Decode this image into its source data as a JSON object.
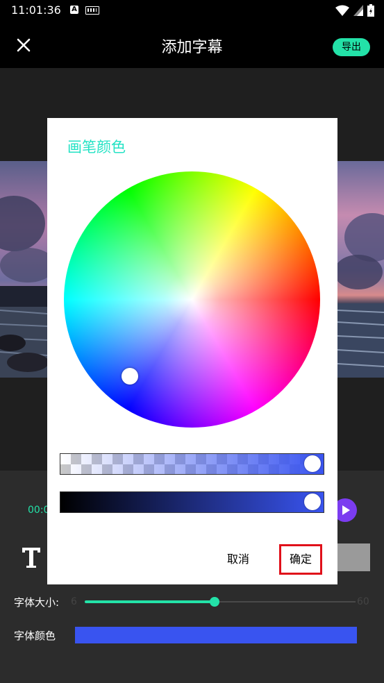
{
  "status_bar": {
    "time": "11:01:36",
    "a_indicator": "A",
    "icons": [
      "a-icon",
      "keyboard-icon",
      "wifi-icon",
      "signal-icon",
      "battery-icon"
    ]
  },
  "header": {
    "title": "添加字幕",
    "export_label": "导出",
    "close_icon": "close-icon"
  },
  "player": {
    "timecode": "00:0",
    "play_icon": "play-icon"
  },
  "controls": {
    "font_size_label": "字体大小:",
    "font_size_min": "6",
    "font_size_max": "60",
    "font_size_fraction": 0.48,
    "font_color_label": "字体颜色",
    "font_color": "#3954f0",
    "text_icon": "text-icon"
  },
  "color_dialog": {
    "title": "画笔颜色",
    "cancel_label": "取消",
    "confirm_label": "确定",
    "selected_color": "#3954f0",
    "alpha_fraction": 1.0,
    "brightness_fraction": 1.0
  },
  "colors": {
    "accent": "#23e2a8",
    "dialog_title": "#23e2c4",
    "confirm_border": "#e0101a",
    "play_button": "#7b3cf0"
  }
}
